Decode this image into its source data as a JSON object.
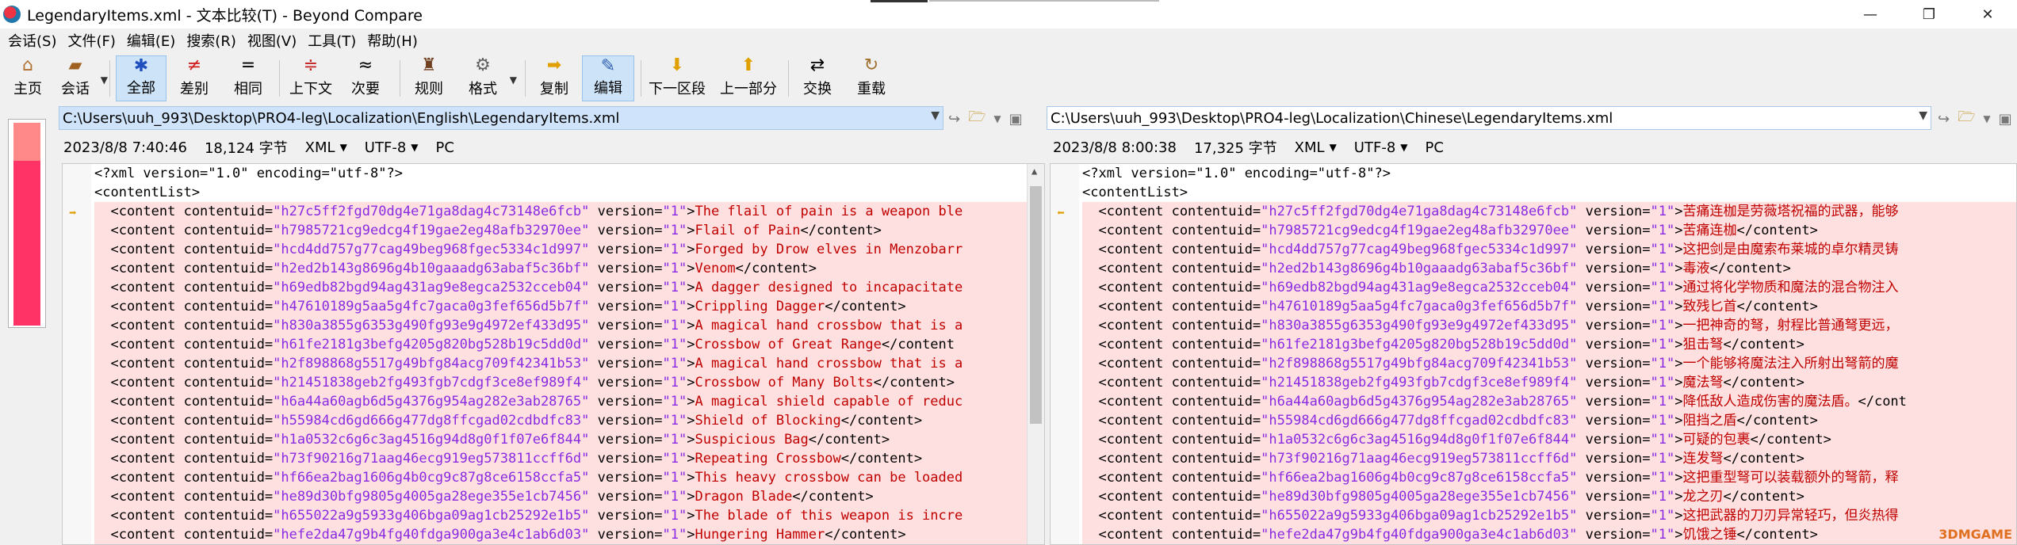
{
  "window": {
    "title": "LegendaryItems.xml - 文本比较(T) - Beyond Compare",
    "min": "—",
    "max": "❐",
    "close": "✕"
  },
  "menu": [
    "会话(S)",
    "文件(F)",
    "编辑(E)",
    "搜索(R)",
    "视图(V)",
    "工具(T)",
    "帮助(H)"
  ],
  "toolbar": {
    "home": "主页",
    "session": "会话",
    "all": "全部",
    "diffs": "差别",
    "same": "相同",
    "context": "上下文",
    "minor": "次要",
    "rules": "规则",
    "format": "格式",
    "copy": "复制",
    "edit": "编辑",
    "next_section": "下一区段",
    "prev_section": "上一部分",
    "swap": "交换",
    "reload": "重载"
  },
  "left": {
    "path": "C:\\Users\\uuh_993\\Desktop\\PRO4-leg\\Localization\\English\\LegendaryItems.xml",
    "date": "2023/8/8 7:40:46",
    "size": "18,124 字节",
    "format": "XML",
    "encoding": "UTF-8",
    "lineend": "PC"
  },
  "right": {
    "path": "C:\\Users\\uuh_993\\Desktop\\PRO4-leg\\Localization\\Chinese\\LegendaryItems.xml",
    "date": "2023/8/8 8:00:38",
    "size": "17,325 字节",
    "format": "XML",
    "encoding": "UTF-8",
    "lineend": "PC"
  },
  "header_lines": [
    "<?xml version=\"1.0\" encoding=\"utf-8\"?>",
    "<contentList>"
  ],
  "rows": [
    {
      "uid": "h27c5ff2fgd70dg4e71ga8dag4c73148e6fcb",
      "en": "The flail of pain is a weapon ble",
      "zh": "苦痛连枷是劳薇塔祝福的武器，能够"
    },
    {
      "uid": "h7985721cg9edcg4f19gae2eg48afb32970ee",
      "en": "Flail of Pain</content>",
      "zh": "苦痛连枷</content>"
    },
    {
      "uid": "hcd4dd757g77cag49beg968fgec5334c1d997",
      "en": "Forged by Drow elves in Menzobarr",
      "zh": "这把剑是由魔索布莱城的卓尔精灵铸"
    },
    {
      "uid": "h2ed2b143g8696g4b10gaaadg63abaf5c36bf",
      "en": "Venom</content>",
      "zh": "毒液</content>"
    },
    {
      "uid": "h69edb82bgd94ag431ag9e8egca2532cceb04",
      "en": "A dagger designed to incapacitate",
      "zh": "通过将化学物质和魔法的混合物注入"
    },
    {
      "uid": "h47610189g5aa5g4fc7gaca0g3fef656d5b7f",
      "en": "Crippling Dagger</content>",
      "zh": "致残匕首</content>"
    },
    {
      "uid": "h830a3855g6353g490fg93e9g4972ef433d95",
      "en": "A magical hand crossbow that is a",
      "zh": "一把神奇的弩，射程比普通弩更远，"
    },
    {
      "uid": "h61fe2181g3befg4205g820bg528b19c5dd0d",
      "en": "Crossbow of Great Range</content",
      "zh": "狙击弩</content>"
    },
    {
      "uid": "h2f898868g5517g49bfg84acg709f42341b53",
      "en": "A magical hand crossbow that is a",
      "zh": "一个能够将魔法注入所射出弩箭的魔"
    },
    {
      "uid": "h21451838geb2fg493fgb7cdgf3ce8ef989f4",
      "en": "Crossbow of Many Bolts</content>",
      "zh": "魔法弩</content>"
    },
    {
      "uid": "h6a44a60agb6d5g4376g954ag282e3ab28765",
      "en": "A magical shield capable of reduc",
      "zh": "降低敌人造成伤害的魔法盾。</cont"
    },
    {
      "uid": "h55984cd6gd666g477dg8ffcgad02cdbdfc83",
      "en": "Shield of Blocking</content>",
      "zh": "阻挡之盾</content>"
    },
    {
      "uid": "h1a0532c6g6c3ag4516g94d8g0f1f07e6f844",
      "en": "Suspicious Bag</content>",
      "zh": "可疑的包裹</content>"
    },
    {
      "uid": "h73f90216g71aag46ecg919eg573811ccff6d",
      "en": "Repeating Crossbow</content>",
      "zh": "连发弩</content>"
    },
    {
      "uid": "hf66ea2bag1606g4b0cg9c87g8ce6158ccfa5",
      "en": "This heavy crossbow can be loaded",
      "zh": "这把重型弩可以装载额外的弩箭，释"
    },
    {
      "uid": "he89d30bfg9805g4005ga28ege355e1cb7456",
      "en": "Dragon Blade</content>",
      "zh": "龙之刃</content>"
    },
    {
      "uid": "h655022a9g5933g406bga09ag1cb25292e1b5",
      "en": "The blade of this weapon is incre",
      "zh": "这把武器的刀刃异常轻巧，但炎热得"
    },
    {
      "uid": "hefe2da47g9b4fg40fdga900ga3e4c1ab6d03",
      "en": "Hungering Hammer</content>",
      "zh": "饥饿之锤</content>"
    }
  ],
  "version_label": "version=",
  "version_value": "\"1\"",
  "watermark": "3DMGAME"
}
